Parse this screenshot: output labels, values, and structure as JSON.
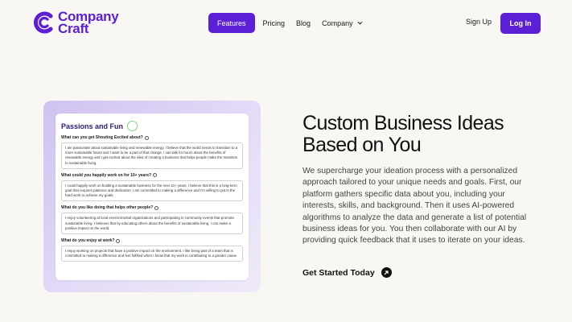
{
  "brand": {
    "name_line1": "Company",
    "name_line2": "Craft",
    "color": "#5b1fd6"
  },
  "nav": {
    "items": [
      {
        "label": "Features",
        "active": true
      },
      {
        "label": "Pricing"
      },
      {
        "label": "Blog"
      },
      {
        "label": "Company",
        "has_dropdown": true
      }
    ],
    "signup": "Sign Up",
    "login": "Log In"
  },
  "preview": {
    "title": "Passions and Fun",
    "questions": [
      {
        "q": "What can you get Shouting Excited about?",
        "a": "I am passionate about sustainable living and renewable energy. I believe that the world needs to transition to a more sustainable future and I want to be a part of that change. I can talk for hours about the benefits of renewable energy and I get excited about the idea of creating a business that helps people make the transition to sustainable living."
      },
      {
        "q": "What could you happily work on for 10+ years?",
        "a": "I could happily work on building a sustainable business for the next 10+ years. I believe that this is a long-term goal that requires patience and dedication. I am committed to making a difference and I'm willing to put in the hard work to achieve my goals."
      },
      {
        "q": "What do you like doing that helps other people?",
        "a": "I enjoy volunteering at local environmental organizations and participating in community events that promote sustainable living. I believes that by educating others about the benefits of sustainable living, I can make a positive impact on the world."
      },
      {
        "q": "What do you enjoy at work?",
        "a": "I enjoy working on projects that have a positive impact on the environment. I like being part of a team that is committed to making a difference and feel fulfilled when I know that my work is contributing to a greater cause."
      }
    ]
  },
  "hero": {
    "headline": "Custom Business Ideas Based on You",
    "description": "We supercharge your ideation process with a personalized approach tailored to your unique needs and goals. First, our platform gathers specific data about you, including your interests, skills, and background. Then it uses AI-powered algorithms to analyze the data and generate a list of potential business ideas for you. You then collaborate with our AI by providing quick feedback that it uses to iterate on your ideas.",
    "cta": "Get Started Today"
  }
}
